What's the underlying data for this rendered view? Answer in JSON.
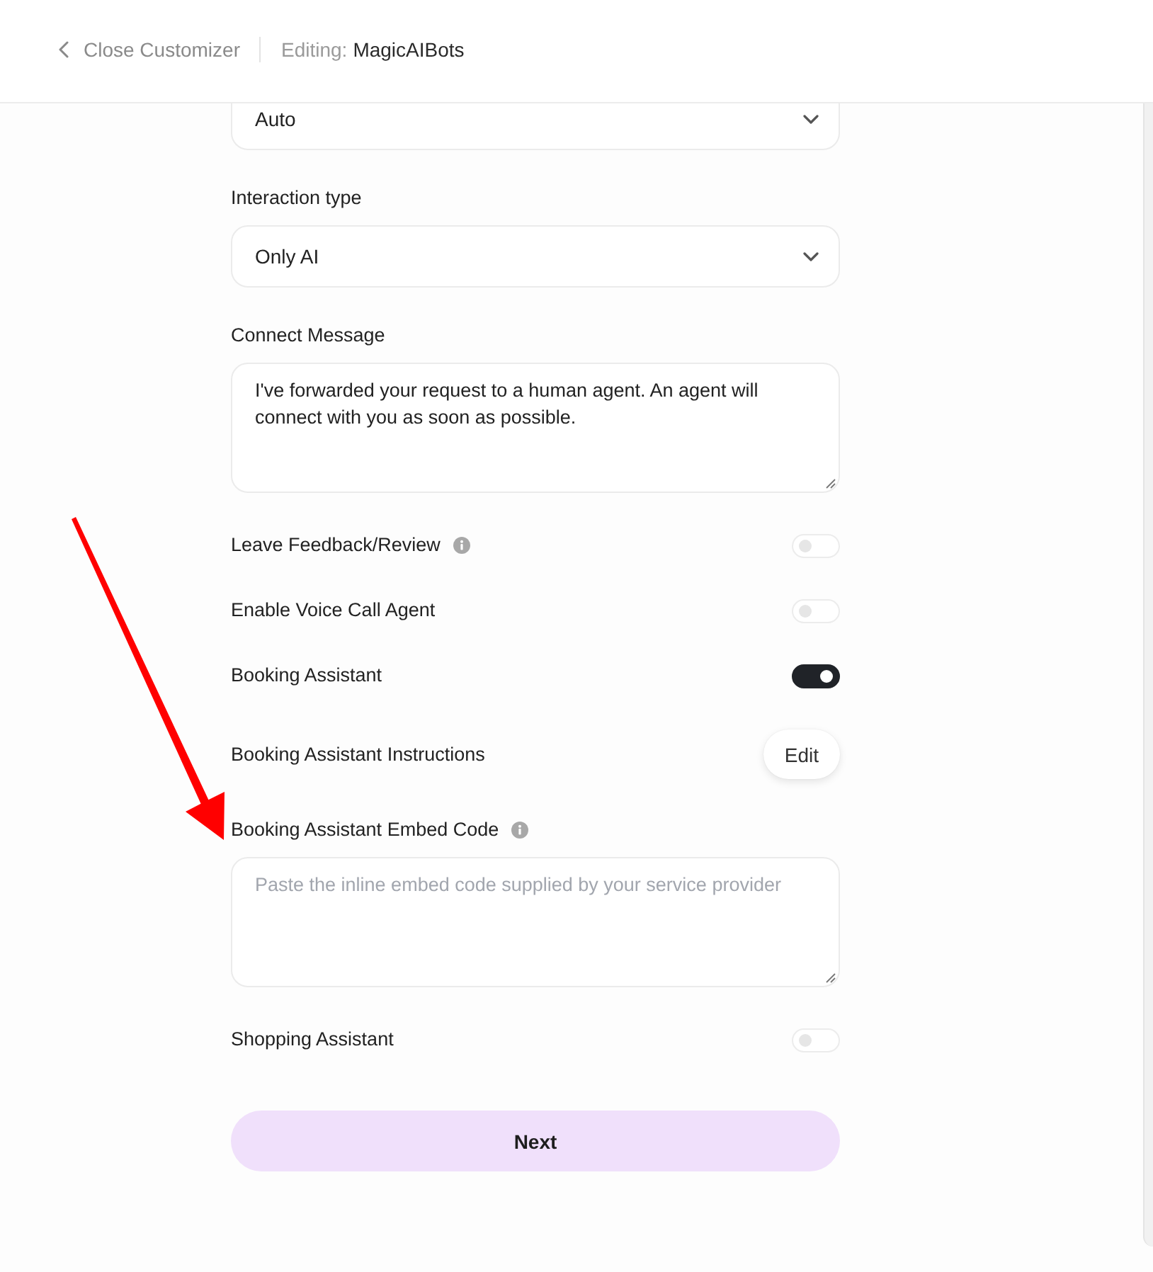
{
  "header": {
    "back_link": "Close Customizer",
    "editing_label": "Editing:",
    "editing_name": "MagicAIBots"
  },
  "fields": [
    {
      "kind": "select",
      "value": "Auto"
    },
    {
      "kind": "select",
      "label": "Interaction type",
      "value": "Only AI"
    },
    {
      "kind": "textarea",
      "label": "Connect Message",
      "value": "I've forwarded your request to a human agent. An agent will connect with you as soon as possible."
    },
    {
      "kind": "toggle",
      "label": "Leave Feedback/Review",
      "info": true,
      "on": false
    },
    {
      "kind": "toggle",
      "label": "Enable Voice Call Agent",
      "on": false
    },
    {
      "kind": "toggle",
      "label": "Booking Assistant",
      "on": true
    },
    {
      "kind": "action",
      "label": "Booking Assistant Instructions",
      "button": "Edit"
    },
    {
      "kind": "textarea",
      "label": "Booking Assistant Embed Code",
      "info": true,
      "placeholder": "Paste the inline embed code supplied by your service provider"
    },
    {
      "kind": "toggle",
      "label": "Shopping Assistant",
      "on": false
    }
  ],
  "next_button": "Next"
}
